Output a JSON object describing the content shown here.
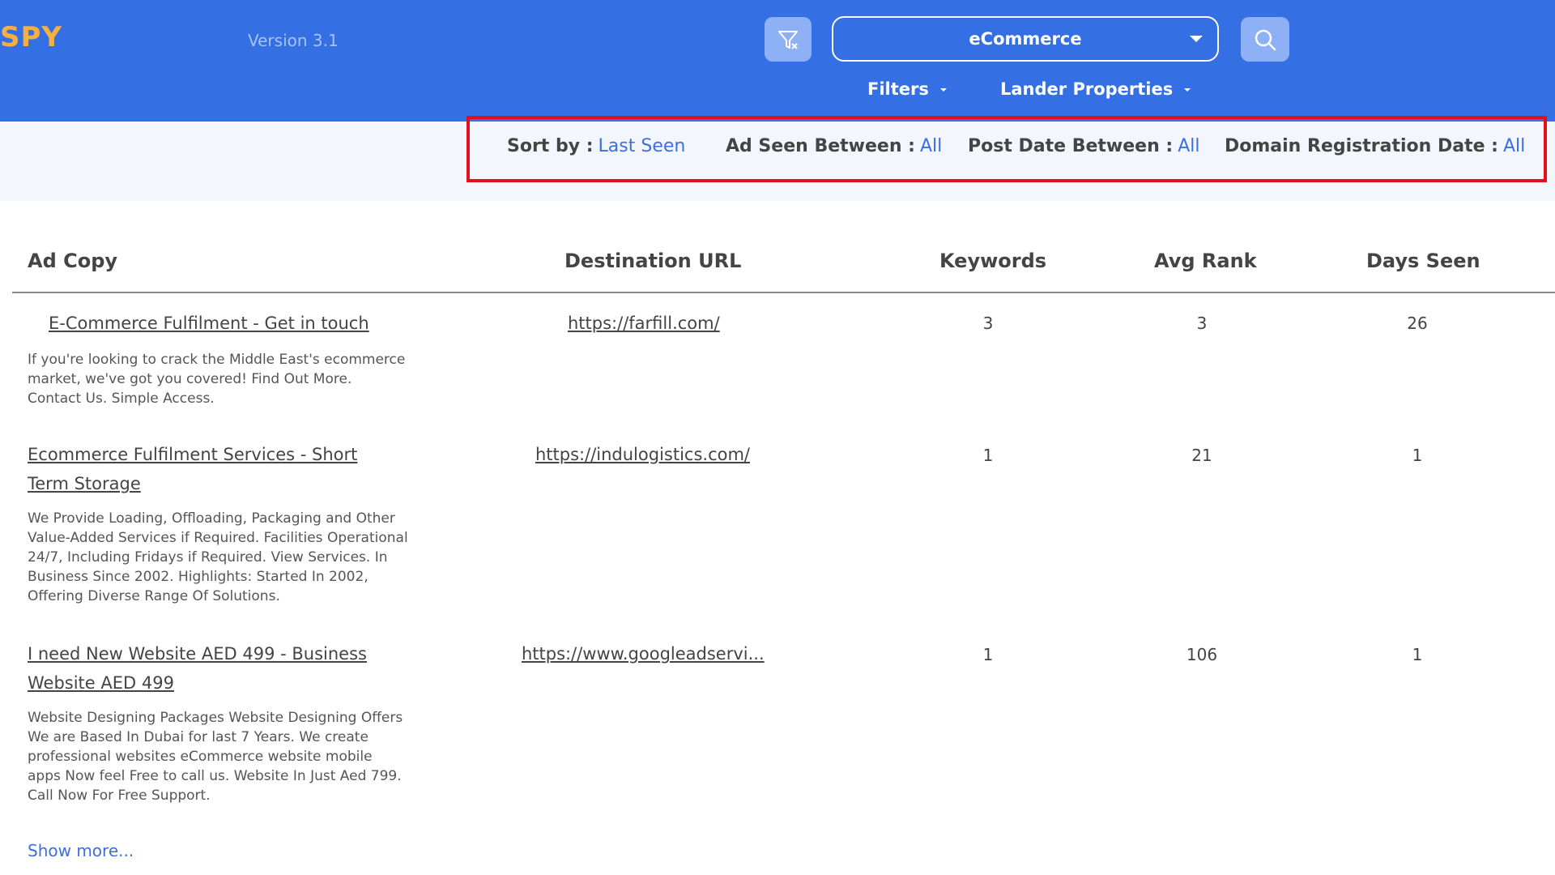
{
  "header": {
    "logo": "SPY",
    "version": "Version 3.1",
    "category": "eCommerce",
    "filters_label": "Filters",
    "lander_label": "Lander Properties",
    "brand_color": "#3470e4",
    "logo_color": "#f5b041"
  },
  "sortbar": {
    "sort_by_label": "Sort by :",
    "sort_by_value": "Last Seen",
    "ad_seen_label": "Ad Seen Between :",
    "ad_seen_value": "All",
    "post_date_label": "Post Date Between :",
    "post_date_value": "All",
    "domain_reg_label": "Domain Registration Date :",
    "domain_reg_value": "All",
    "highlight_color": "#e3101b"
  },
  "table": {
    "columns": [
      "Ad Copy",
      "Destination URL",
      "Keywords",
      "Avg Rank",
      "Days Seen"
    ],
    "rows": [
      {
        "title": "E-Commerce Fulfilment - Get in touch",
        "description": "If you're looking to crack the Middle East's ecommerce market, we've got you covered! Find Out More. Contact Us. Simple Access.",
        "url": "https://farfill.com/",
        "keywords": "3",
        "avg_rank": "3",
        "days_seen": "26"
      },
      {
        "title": "Ecommerce Fulfilment Services - Short Term Storage",
        "description": "We Provide Loading, Offloading, Packaging and Other Value-Added Services if Required. Facilities Operational 24/7, Including Fridays if Required. View Services. In Business Since 2002. Highlights: Started In 2002, Offering Diverse Range Of Solutions.",
        "url": "https://indulogistics.com/",
        "keywords": "1",
        "avg_rank": "21",
        "days_seen": "1"
      },
      {
        "title": "I need New Website AED 499 - Business Website AED 499",
        "description": "Website Designing Packages Website Designing Offers We are Based In Dubai for last 7 Years. We create professional websites eCommerce website mobile apps Now feel Free to call us. Website In Just Aed 799. Call Now For Free Support.",
        "url": "https://www.googleadservi...",
        "keywords": "1",
        "avg_rank": "106",
        "days_seen": "1"
      }
    ],
    "show_more": "Show more..."
  }
}
